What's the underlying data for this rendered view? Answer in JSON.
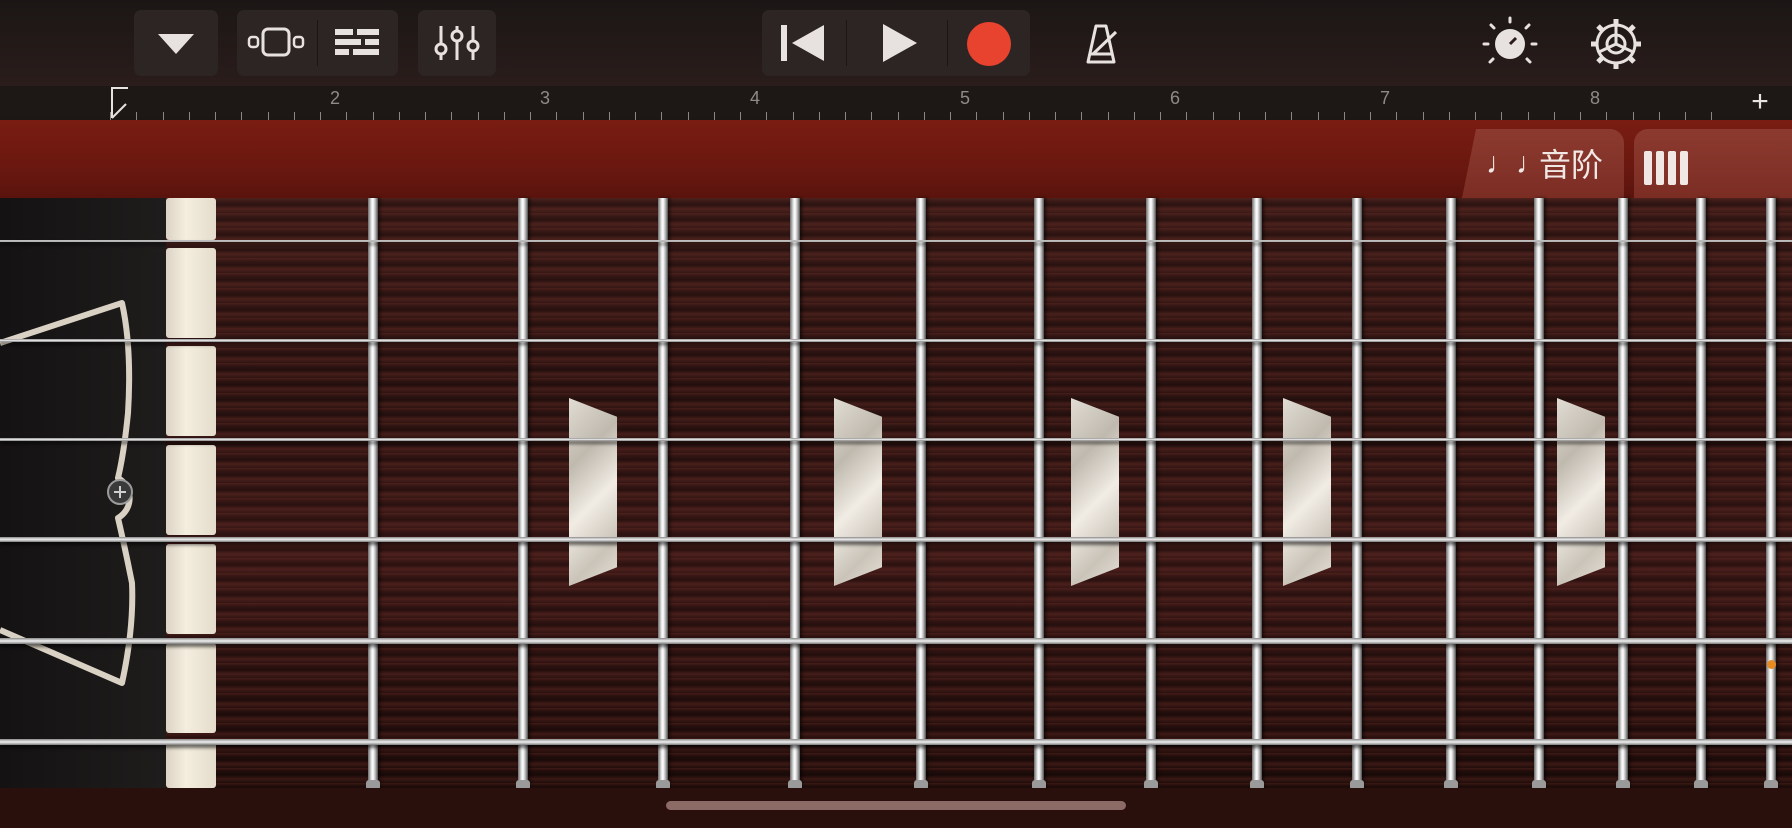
{
  "toolbar": {
    "buttons": [
      {
        "name": "browser-menu-button",
        "icon": "chevron-down-icon"
      },
      {
        "name": "tracks-view-button",
        "icon": "track-view-icon"
      },
      {
        "name": "smart-controls-button",
        "icon": "list-icon"
      },
      {
        "name": "mixer-button",
        "icon": "sliders-icon"
      },
      {
        "name": "go-to-beginning-button",
        "icon": "skip-back-icon"
      },
      {
        "name": "play-button",
        "icon": "play-icon"
      },
      {
        "name": "record-button",
        "icon": "record-icon"
      },
      {
        "name": "metronome-button",
        "icon": "metronome-icon"
      },
      {
        "name": "master-effects-button",
        "icon": "dial-icon"
      },
      {
        "name": "settings-button",
        "icon": "gear-icon"
      }
    ],
    "record_color": "#e8432f"
  },
  "ruler": {
    "bars": [
      "2",
      "3",
      "4",
      "5",
      "6",
      "7",
      "8"
    ],
    "add_label": "+"
  },
  "controls": {
    "scale_icon": "♩♩",
    "scale_label": "音阶",
    "layout_icon": "notes-layout-icon"
  },
  "fretboard": {
    "string_count": 6,
    "fret_count": 14,
    "inlay_frets": [
      3,
      5,
      7,
      9,
      12
    ],
    "position_marker_color": "#e68a22"
  }
}
